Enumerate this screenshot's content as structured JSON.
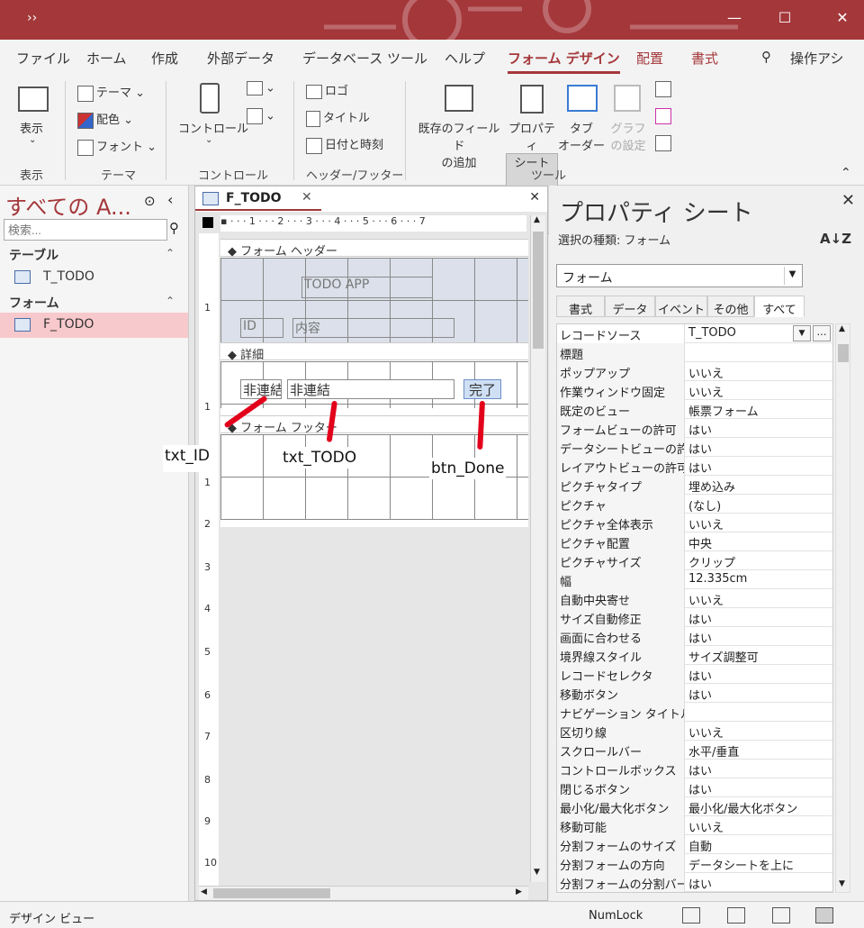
{
  "titlebar": {
    "qa": "››",
    "minimize": "—",
    "maximize": "☐",
    "close": "✕"
  },
  "tabs": [
    {
      "label": "ファイル"
    },
    {
      "label": "ホーム"
    },
    {
      "label": "作成"
    },
    {
      "label": "外部データ"
    },
    {
      "label": "データベース ツール"
    },
    {
      "label": "ヘルプ"
    },
    {
      "label": "フォーム デザイン"
    },
    {
      "label": "配置"
    },
    {
      "label": "書式"
    },
    {
      "label": "操作アシ"
    }
  ],
  "ribbon": {
    "view": {
      "label": "表示",
      "group": "表示"
    },
    "theme": {
      "theme": "テーマ",
      "colors": "配色",
      "fonts": "フォント",
      "group": "テーマ"
    },
    "controls": {
      "label": "コントロール",
      "group": "コントロール"
    },
    "header": {
      "logo": "ロゴ",
      "title": "タイトル",
      "datetime": "日付と時刻",
      "group": "ヘッダー/フッター"
    },
    "tools": {
      "existing_fields": "既存のフィールド\nの追加",
      "property_sheet": "プロパティ\nシート",
      "tab_order": "タブ\nオーダー",
      "chart_settings": "グラフ\nの設定",
      "group": "ツール"
    }
  },
  "nav": {
    "title": "すべての A...",
    "search_placeholder": "検索...",
    "categories": [
      {
        "label": "テーブル",
        "items": [
          {
            "label": "T_TODO"
          }
        ]
      },
      {
        "label": "フォーム",
        "items": [
          {
            "label": "F_TODO"
          }
        ]
      }
    ]
  },
  "document": {
    "tab": "F_TODO",
    "ruler_marks": "▪  ·  ·  ·  1  ·  ·  ·  2  ·  ·  ·  3  ·  ·  ·  4  ·  ·  ·  5  ·  ·  ·  6  ·  ·  ·  7",
    "ruler_left": [
      "1",
      "1",
      "1",
      "2",
      "3",
      "4",
      "5",
      "6",
      "7",
      "8",
      "9",
      "10"
    ],
    "sections": {
      "header": "フォーム ヘッダー",
      "detail": "詳細",
      "footer": "フォーム フッター"
    },
    "controls": {
      "title_label": "TODO  APP",
      "id_label": "ID",
      "content_label": "内容",
      "txt_id": "非連結",
      "txt_todo": "非連結",
      "btn_done": "完了"
    },
    "annotations": {
      "txt_id": "txt_ID",
      "txt_todo": "txt_TODO",
      "btn_done": "btn_Done"
    }
  },
  "properties": {
    "title": "プロパティ シート",
    "selection_type": "選択の種類: フォーム",
    "combo_value": "フォーム",
    "tabs": [
      "書式",
      "データ",
      "イベント",
      "その他",
      "すべて"
    ],
    "active_tab": "すべて",
    "rows": [
      {
        "name": "レコードソース",
        "value": "T_TODO"
      },
      {
        "name": "標題",
        "value": ""
      },
      {
        "name": "ポップアップ",
        "value": "いいえ"
      },
      {
        "name": "作業ウィンドウ固定",
        "value": "いいえ"
      },
      {
        "name": "既定のビュー",
        "value": "帳票フォーム"
      },
      {
        "name": "フォームビューの許可",
        "value": "はい"
      },
      {
        "name": "データシートビューの許可",
        "value": "はい"
      },
      {
        "name": "レイアウトビューの許可",
        "value": "はい"
      },
      {
        "name": "ピクチャタイプ",
        "value": "埋め込み"
      },
      {
        "name": "ピクチャ",
        "value": "(なし)"
      },
      {
        "name": "ピクチャ全体表示",
        "value": "いいえ"
      },
      {
        "name": "ピクチャ配置",
        "value": "中央"
      },
      {
        "name": "ピクチャサイズ",
        "value": "クリップ"
      },
      {
        "name": "幅",
        "value": "12.335cm"
      },
      {
        "name": "自動中央寄せ",
        "value": "いいえ"
      },
      {
        "name": "サイズ自動修正",
        "value": "はい"
      },
      {
        "name": "画面に合わせる",
        "value": "はい"
      },
      {
        "name": "境界線スタイル",
        "value": "サイズ調整可"
      },
      {
        "name": "レコードセレクタ",
        "value": "はい"
      },
      {
        "name": "移動ボタン",
        "value": "はい"
      },
      {
        "name": "ナビゲーション タイトル",
        "value": ""
      },
      {
        "name": "区切り線",
        "value": "いいえ"
      },
      {
        "name": "スクロールバー",
        "value": "水平/垂直"
      },
      {
        "name": "コントロールボックス",
        "value": "はい"
      },
      {
        "name": "閉じるボタン",
        "value": "はい"
      },
      {
        "name": "最小化/最大化ボタン",
        "value": "最小化/最大化ボタン"
      },
      {
        "name": "移動可能",
        "value": "いいえ"
      },
      {
        "name": "分割フォームのサイズ",
        "value": "自動"
      },
      {
        "name": "分割フォームの方向",
        "value": "データシートを上に"
      },
      {
        "name": "分割フォームの分割バー",
        "value": "はい"
      }
    ]
  },
  "status": {
    "left": "デザイン ビュー",
    "numlock": "NumLock"
  }
}
